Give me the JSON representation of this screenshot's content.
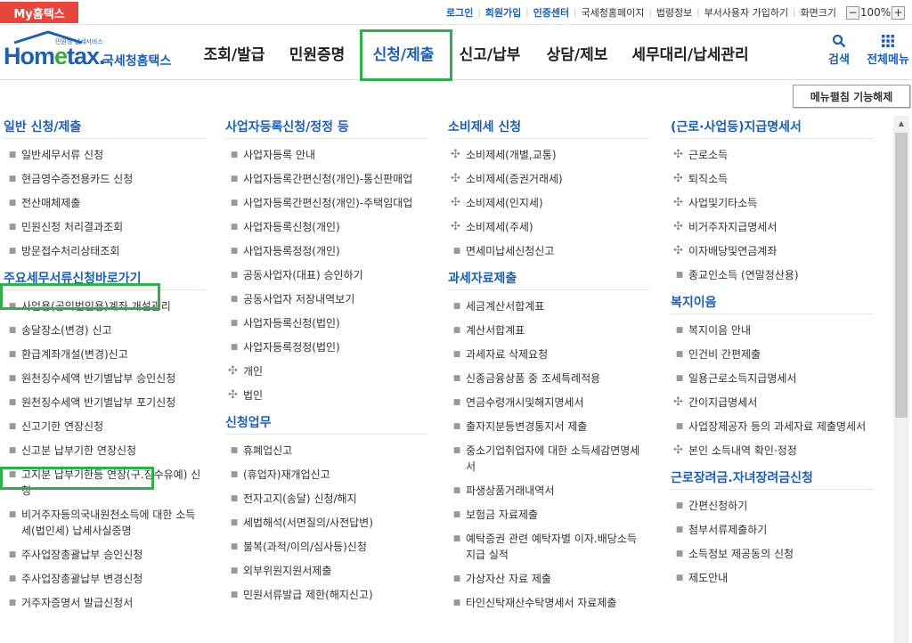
{
  "topbar": {
    "my_hometax": "My홈택스",
    "links": [
      {
        "label": "로그인",
        "blue": true
      },
      {
        "label": "회원가입",
        "blue": true
      },
      {
        "label": "인증센터",
        "blue": true
      },
      {
        "label": "국세청홈페이지",
        "blue": false
      },
      {
        "label": "법령정보",
        "blue": false
      },
      {
        "label": "부서사용자 가입하기",
        "blue": false
      },
      {
        "label": "화면크기",
        "blue": false
      }
    ],
    "zoom_minus": "−",
    "zoom_value": "100%",
    "zoom_plus": "+"
  },
  "logo": {
    "tagline": "민원형 납세서비스",
    "word_start": "Hom",
    "word_e": "e",
    "word_end": "tax.",
    "korean": "국세청홈택스"
  },
  "gnb": [
    {
      "label": "조회/발급",
      "active": false
    },
    {
      "label": "민원증명",
      "active": false
    },
    {
      "label": "신청/제출",
      "active": true
    },
    {
      "label": "신고/납부",
      "active": false
    },
    {
      "label": "상담/제보",
      "active": false
    },
    {
      "label": "세무대리/납세관리",
      "active": false
    }
  ],
  "header_icons": {
    "search": "검색",
    "all_menu": "전체메뉴"
  },
  "fold_button": "메뉴펼침 기능해제",
  "columns": [
    {
      "sections": [
        {
          "title": "일반 신청/제출",
          "items": [
            {
              "label": "일반세무서류 신청",
              "plus": false
            },
            {
              "label": "현금영수증전용카드 신청",
              "plus": false
            },
            {
              "label": "전산매체제출",
              "plus": false
            },
            {
              "label": "민원신청 처리결과조회",
              "plus": false
            },
            {
              "label": "방문접수처리상태조회",
              "plus": false
            }
          ]
        },
        {
          "title": "주요세무서류신청바로가기",
          "items": [
            {
              "label": "사업용(공익법인용)계좌 개설관리",
              "plus": false
            },
            {
              "label": "송달장소(변경) 신고",
              "plus": false
            },
            {
              "label": "환급계좌개설(변경)신고",
              "plus": false
            },
            {
              "label": "원천징수세액 반기별납부 승인신청",
              "plus": false
            },
            {
              "label": "원천징수세액 반기별납부 포기신청",
              "plus": false
            },
            {
              "label": "신고기한 연장신청",
              "plus": false
            },
            {
              "label": "신고분 납부기한 연장신청",
              "plus": false
            },
            {
              "label": "고지분 납부기한등 연장(구.징수유예) 신청",
              "plus": false
            },
            {
              "label": "비거주자등의국내원천소득에 대한 소득세(법인세) 납세사실증명",
              "plus": false
            },
            {
              "label": "주사업장총괄납부 승인신청",
              "plus": false
            },
            {
              "label": "주사업장총괄납부 변경신청",
              "plus": false
            },
            {
              "label": "거주자증명서 발급신청서",
              "plus": false
            }
          ]
        }
      ]
    },
    {
      "sections": [
        {
          "title": "사업자등록신청/정정 등",
          "items": [
            {
              "label": "사업자등록 안내",
              "plus": false
            },
            {
              "label": "사업자등록간편신청(개인)-통신판매업",
              "plus": false
            },
            {
              "label": "사업자등록간편신청(개인)-주택임대업",
              "plus": false
            },
            {
              "label": "사업자등록신청(개인)",
              "plus": false
            },
            {
              "label": "사업자등록정정(개인)",
              "plus": false
            },
            {
              "label": "공동사업자(대표) 승인하기",
              "plus": false
            },
            {
              "label": "공동사업자 저장내역보기",
              "plus": false
            },
            {
              "label": "사업자등록신청(법인)",
              "plus": false
            },
            {
              "label": "사업자등록정정(법인)",
              "plus": false
            },
            {
              "label": "개인",
              "plus": true
            },
            {
              "label": "법인",
              "plus": true
            }
          ]
        },
        {
          "title": "신청업무",
          "items": [
            {
              "label": "휴폐업신고",
              "plus": false
            },
            {
              "label": "(휴업자)재개업신고",
              "plus": false
            },
            {
              "label": "전자고지(송달) 신청/해지",
              "plus": false
            },
            {
              "label": "세법해석(서면질의/사전답변)",
              "plus": false
            },
            {
              "label": "불복(과적/이의/심사등)신청",
              "plus": false
            },
            {
              "label": "외부위원지원서제출",
              "plus": false
            },
            {
              "label": "민원서류발급 제한(해지신고)",
              "plus": false
            }
          ]
        }
      ]
    },
    {
      "sections": [
        {
          "title": "소비제세 신청",
          "items": [
            {
              "label": "소비제세(개별,교통)",
              "plus": true
            },
            {
              "label": "소비제세(증권거래세)",
              "plus": true
            },
            {
              "label": "소비제세(인지세)",
              "plus": true
            },
            {
              "label": "소비제세(주세)",
              "plus": true
            },
            {
              "label": "면세미납세신청신고",
              "plus": false
            }
          ]
        },
        {
          "title": "과세자료제출",
          "items": [
            {
              "label": "세금계산서합계표",
              "plus": false
            },
            {
              "label": "계산서합계표",
              "plus": false
            },
            {
              "label": "과세자료 삭제요청",
              "plus": false
            },
            {
              "label": "신종금융상품 중 조세특례적용",
              "plus": false
            },
            {
              "label": "연금수령개시및해지명세서",
              "plus": false
            },
            {
              "label": "출자지분등변경통지서 제출",
              "plus": false
            },
            {
              "label": "중소기업취업자에 대한 소득세감면명세서",
              "plus": false
            },
            {
              "label": "파생상품거래내역서",
              "plus": false
            },
            {
              "label": "보험금 자료제출",
              "plus": false
            },
            {
              "label": "예탁증권 관련 예탁자별 이자.배당소득 지급 실적",
              "plus": false
            },
            {
              "label": "가상자산 자료 제출",
              "plus": false
            },
            {
              "label": "타인신탁재산수탁명세서 자료제출",
              "plus": false
            }
          ]
        }
      ]
    },
    {
      "sections": [
        {
          "title": "(근로·사업등)지급명세서",
          "items": [
            {
              "label": "근로소득",
              "plus": true
            },
            {
              "label": "퇴직소득",
              "plus": true
            },
            {
              "label": "사업및기타소득",
              "plus": true
            },
            {
              "label": "비거주자지급명세서",
              "plus": true
            },
            {
              "label": "이자배당및연금계좌",
              "plus": true
            },
            {
              "label": "종교인소득 (연말정산용)",
              "plus": false
            }
          ]
        },
        {
          "title": "복지이음",
          "items": [
            {
              "label": "복지이음 안내",
              "plus": false
            },
            {
              "label": "인건비 간편제출",
              "plus": false
            },
            {
              "label": "일용근로소득지급명세서",
              "plus": false
            },
            {
              "label": "간이지급명세서",
              "plus": true
            },
            {
              "label": "사업장제공자 등의 과세자료 제출명세서",
              "plus": false
            },
            {
              "label": "본인 소득내역 확인·정정",
              "plus": true
            }
          ]
        },
        {
          "title": "근로장려금.자녀장려금신청",
          "items": [
            {
              "label": "간편신청하기",
              "plus": false
            },
            {
              "label": "첨부서류제출하기",
              "plus": false
            },
            {
              "label": "소득정보 제공동의 신청",
              "plus": false
            },
            {
              "label": "제도안내",
              "plus": false
            }
          ]
        }
      ]
    }
  ]
}
